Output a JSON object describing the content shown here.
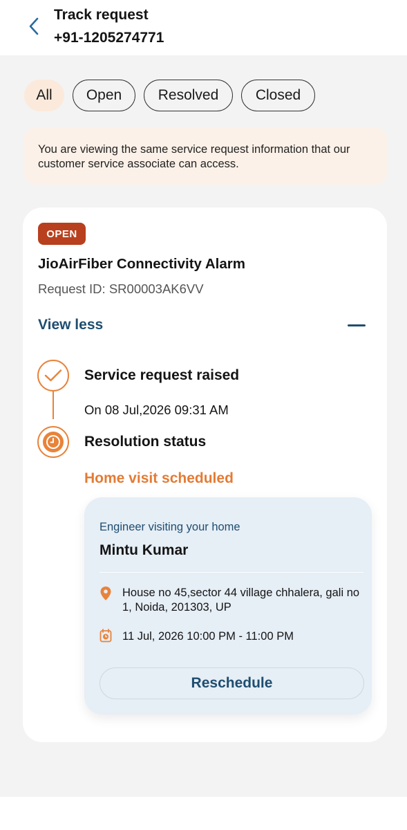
{
  "header": {
    "title": "Track request",
    "phone": "+91-1205274771",
    "back_icon": "chevron-left-icon"
  },
  "filters": {
    "all": "All",
    "open": "Open",
    "resolved": "Resolved",
    "closed": "Closed",
    "selected": "All"
  },
  "notice": {
    "text": "You are viewing the same service request information that our customer service associate can access."
  },
  "request": {
    "status_badge": "OPEN",
    "title": "JioAirFiber Connectivity Alarm",
    "request_id": "Request ID: SR00003AK6VV",
    "toggle_label": "View less",
    "steps": [
      {
        "title": "Service request raised",
        "detail": "On 08 Jul,2026 09:31 AM",
        "icon": "check-circle-icon"
      },
      {
        "title": "Resolution status",
        "detail": "Home visit scheduled",
        "icon": "clock-icon"
      }
    ],
    "visit": {
      "label": "Engineer visiting your home",
      "engineer": "Mintu Kumar",
      "address": "House no 45,sector 44 village chhalera, gali no 1, Noida, 201303, UP",
      "time_slot": "11 Jul, 2026 10:00 PM - 11:00 PM",
      "reschedule_label": "Reschedule"
    }
  },
  "colors": {
    "accent_orange": "#e8833a",
    "badge_red": "#b8401e",
    "link_blue": "#1f4d6f",
    "chip_active_bg": "#fbeadb",
    "notice_bg": "#fbf1e8",
    "visit_card_bg": "#e6eef6"
  }
}
